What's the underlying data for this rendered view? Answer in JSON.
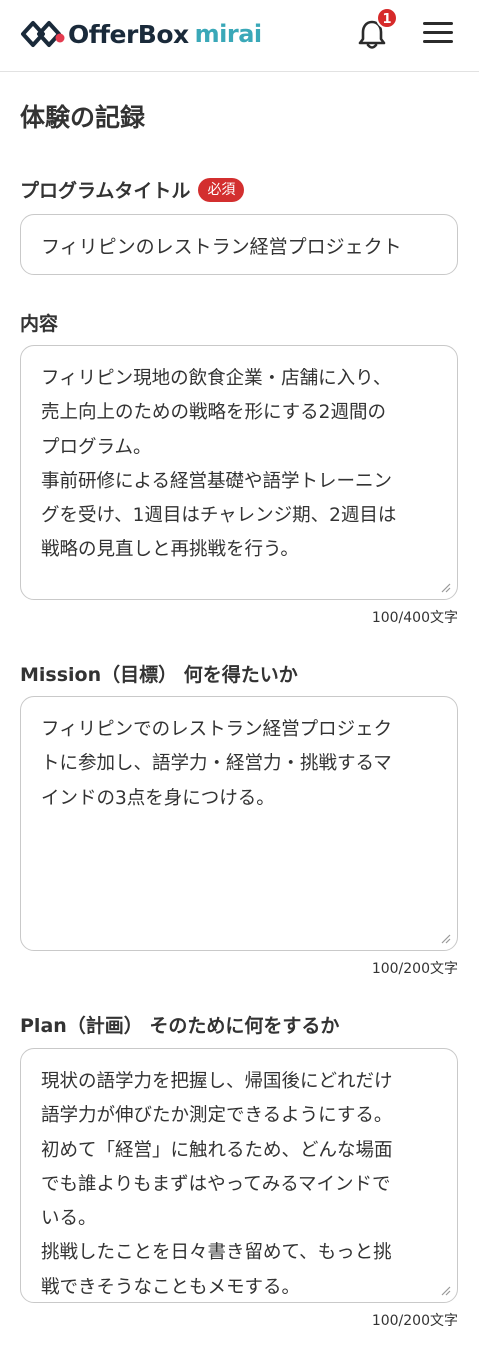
{
  "header": {
    "brand": "OfferBox",
    "brand_sub": "mirai",
    "notification_count": "1",
    "icons": {
      "bell": "bell-icon",
      "menu": "hamburger-menu-icon",
      "logo": "offerbox-logo-icon"
    },
    "colors": {
      "badge": "#d62a2a",
      "brand_sub": "#3aa8b8",
      "brand": "#1a2a3a"
    }
  },
  "page": {
    "title": "体験の記録"
  },
  "form": {
    "program_title": {
      "label": "プログラムタイトル",
      "required_badge": "必須",
      "value": "フィリピンのレストラン経営プロジェクト"
    },
    "content": {
      "label": "内容",
      "lines": [
        "フィリピン現地の飲食企業・店舗に入り、",
        "売上向上のための戦略を形にする2週間の",
        "プログラム。",
        "事前研修による経営基礎や語学トレーニン",
        "グを受け、1週目はチャレンジ期、2週目は",
        "戦略の見直しと再挑戦を行う。"
      ],
      "counter": "100/400文字"
    },
    "mission": {
      "label": "Mission（目標） 何を得たいか",
      "lines": [
        "フィリピンでのレストラン経営プロジェク",
        "トに参加し、語学力・経営力・挑戦するマ",
        "インドの3点を身につける。"
      ],
      "counter": "100/200文字"
    },
    "plan": {
      "label": "Plan（計画） そのために何をするか",
      "lines": [
        "現状の語学力を把握し、帰国後にどれだけ",
        "語学力が伸びたか測定できるようにする。",
        "初めて「経営」に触れるため、どんな場面",
        "でも誰よりもまずはやってみるマインドで",
        "いる。",
        "挑戦したことを日々書き留めて、もっと挑",
        "戦できそうなこともメモする。"
      ],
      "counter": "100/200文字"
    }
  }
}
